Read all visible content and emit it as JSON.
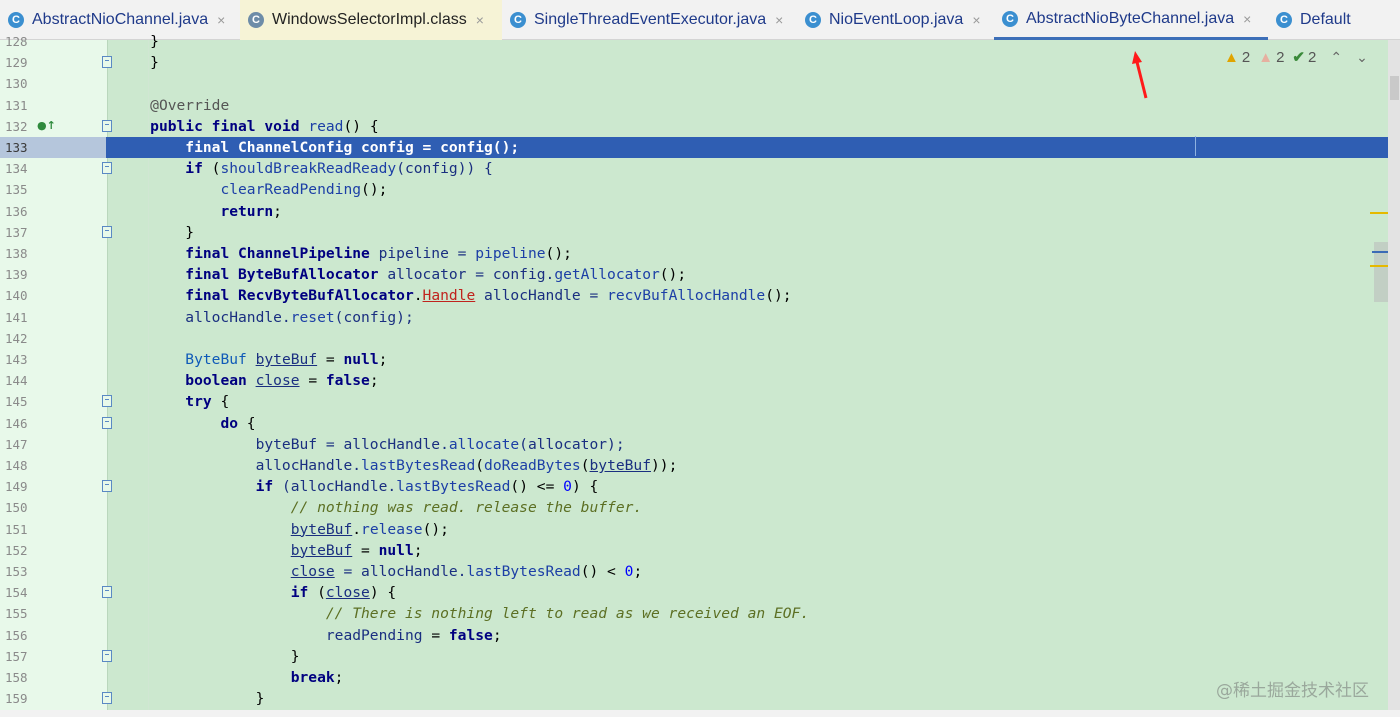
{
  "tabs": [
    {
      "label": "AbstractNioChannel.java",
      "icon": "java-class-icon",
      "kind": "java",
      "active": false,
      "closable": true
    },
    {
      "label": "WindowsSelectorImpl.class",
      "icon": "compiled-class-icon",
      "kind": "class",
      "active": false,
      "closable": true
    },
    {
      "label": "SingleThreadEventExecutor.java",
      "icon": "java-class-icon",
      "kind": "java",
      "active": false,
      "closable": true
    },
    {
      "label": "NioEventLoop.java",
      "icon": "java-class-icon",
      "kind": "java",
      "active": false,
      "closable": true
    },
    {
      "label": "AbstractNioByteChannel.java",
      "icon": "java-class-icon",
      "kind": "java",
      "active": true,
      "closable": true
    },
    {
      "label": "Default",
      "icon": "java-class-icon",
      "kind": "java",
      "active": false,
      "closable": false
    }
  ],
  "tab_icon_letter": "C",
  "close_glyph": "×",
  "inspections": {
    "warnings": "2",
    "weak_warnings": "2",
    "typos": "2",
    "warn_glyph": "▲",
    "weak_glyph": "▲",
    "typo_glyph": "✔",
    "prev_glyph": "⌃",
    "next_glyph": "⌄"
  },
  "editor": {
    "current_line": "133",
    "lines": [
      {
        "n": "128",
        "code": [
          {
            "t": "    }",
            "c": ""
          }
        ]
      },
      {
        "n": "129",
        "fold": true,
        "code": [
          {
            "t": "    }",
            "c": ""
          }
        ]
      },
      {
        "n": "130",
        "code": []
      },
      {
        "n": "131",
        "code": [
          {
            "t": "    ",
            "c": ""
          },
          {
            "t": "@Override",
            "c": "an"
          }
        ]
      },
      {
        "n": "132",
        "fold": true,
        "marker": "●↑",
        "code": [
          {
            "t": "    ",
            "c": ""
          },
          {
            "t": "public final void ",
            "c": "kw"
          },
          {
            "t": "read",
            "c": "fn"
          },
          {
            "t": "() {",
            "c": ""
          }
        ]
      },
      {
        "n": "133",
        "current": true,
        "code": [
          {
            "t": "        final ChannelConfig config = config();",
            "c": ""
          }
        ]
      },
      {
        "n": "134",
        "fold": true,
        "code": [
          {
            "t": "        ",
            "c": ""
          },
          {
            "t": "if ",
            "c": "kw"
          },
          {
            "t": "(",
            "c": ""
          },
          {
            "t": "shouldBreakReadReady",
            "c": "fn"
          },
          {
            "t": "(config)) {",
            "c": "lvar"
          }
        ]
      },
      {
        "n": "135",
        "code": [
          {
            "t": "            ",
            "c": ""
          },
          {
            "t": "clearReadPending",
            "c": "fn"
          },
          {
            "t": "();",
            "c": ""
          }
        ]
      },
      {
        "n": "136",
        "code": [
          {
            "t": "            ",
            "c": ""
          },
          {
            "t": "return",
            "c": "kw"
          },
          {
            "t": ";",
            "c": ""
          }
        ]
      },
      {
        "n": "137",
        "fold": true,
        "code": [
          {
            "t": "        }",
            "c": ""
          }
        ]
      },
      {
        "n": "138",
        "code": [
          {
            "t": "        ",
            "c": ""
          },
          {
            "t": "final ChannelPipeline ",
            "c": "kw"
          },
          {
            "t": "pipeline = ",
            "c": "lvar"
          },
          {
            "t": "pipeline",
            "c": "fn"
          },
          {
            "t": "();",
            "c": ""
          }
        ]
      },
      {
        "n": "139",
        "code": [
          {
            "t": "        ",
            "c": ""
          },
          {
            "t": "final ByteBufAllocator ",
            "c": "kw"
          },
          {
            "t": "allocator = config.",
            "c": "lvar"
          },
          {
            "t": "getAllocator",
            "c": "fn"
          },
          {
            "t": "();",
            "c": ""
          }
        ]
      },
      {
        "n": "140",
        "code": [
          {
            "t": "        ",
            "c": ""
          },
          {
            "t": "final RecvByteBufAllocator",
            "c": "kw"
          },
          {
            "t": ".",
            "c": ""
          },
          {
            "t": "Handle",
            "c": "err"
          },
          {
            "t": " allocHandle = ",
            "c": "lvar"
          },
          {
            "t": "recvBufAllocHandle",
            "c": "fn"
          },
          {
            "t": "();",
            "c": ""
          }
        ]
      },
      {
        "n": "141",
        "code": [
          {
            "t": "        allocHandle.",
            "c": "lvar"
          },
          {
            "t": "reset",
            "c": "fn"
          },
          {
            "t": "(config);",
            "c": "lvar"
          }
        ]
      },
      {
        "n": "142",
        "code": []
      },
      {
        "n": "143",
        "code": [
          {
            "t": "        ",
            "c": ""
          },
          {
            "t": "ByteBuf",
            "c": "ty"
          },
          {
            "t": " ",
            "c": ""
          },
          {
            "t": "byteBuf",
            "c": "lvar ul"
          },
          {
            "t": " = ",
            "c": ""
          },
          {
            "t": "null",
            "c": "kw"
          },
          {
            "t": ";",
            "c": ""
          }
        ]
      },
      {
        "n": "144",
        "code": [
          {
            "t": "        ",
            "c": ""
          },
          {
            "t": "boolean ",
            "c": "kw"
          },
          {
            "t": "close",
            "c": "lvar ul"
          },
          {
            "t": " = ",
            "c": ""
          },
          {
            "t": "false",
            "c": "kw"
          },
          {
            "t": ";",
            "c": ""
          }
        ]
      },
      {
        "n": "145",
        "fold": true,
        "code": [
          {
            "t": "        ",
            "c": ""
          },
          {
            "t": "try ",
            "c": "kw"
          },
          {
            "t": "{",
            "c": ""
          }
        ]
      },
      {
        "n": "146",
        "fold": true,
        "code": [
          {
            "t": "            ",
            "c": ""
          },
          {
            "t": "do ",
            "c": "kw"
          },
          {
            "t": "{",
            "c": ""
          }
        ]
      },
      {
        "n": "147",
        "code": [
          {
            "t": "                byteBuf = allocHandle.",
            "c": "lvar"
          },
          {
            "t": "allocate",
            "c": "fn"
          },
          {
            "t": "(allocator);",
            "c": "lvar"
          }
        ]
      },
      {
        "n": "148",
        "code": [
          {
            "t": "                allocHandle.",
            "c": "lvar"
          },
          {
            "t": "lastBytesRead",
            "c": "fn"
          },
          {
            "t": "(",
            "c": ""
          },
          {
            "t": "doReadBytes",
            "c": "fn"
          },
          {
            "t": "(",
            "c": ""
          },
          {
            "t": "byteBuf",
            "c": "lvar ul"
          },
          {
            "t": "));",
            "c": ""
          }
        ]
      },
      {
        "n": "149",
        "fold": true,
        "code": [
          {
            "t": "                ",
            "c": ""
          },
          {
            "t": "if ",
            "c": "kw"
          },
          {
            "t": "(allocHandle.",
            "c": "lvar"
          },
          {
            "t": "lastBytesRead",
            "c": "fn"
          },
          {
            "t": "() <= ",
            "c": ""
          },
          {
            "t": "0",
            "c": "num"
          },
          {
            "t": ") {",
            "c": ""
          }
        ]
      },
      {
        "n": "150",
        "code": [
          {
            "t": "                    ",
            "c": ""
          },
          {
            "t": "// nothing was read. release the buffer.",
            "c": "cm"
          }
        ]
      },
      {
        "n": "151",
        "code": [
          {
            "t": "                    ",
            "c": ""
          },
          {
            "t": "byteBuf",
            "c": "lvar ul"
          },
          {
            "t": ".",
            "c": ""
          },
          {
            "t": "release",
            "c": "fn"
          },
          {
            "t": "();",
            "c": ""
          }
        ]
      },
      {
        "n": "152",
        "code": [
          {
            "t": "                    ",
            "c": ""
          },
          {
            "t": "byteBuf",
            "c": "lvar ul"
          },
          {
            "t": " = ",
            "c": ""
          },
          {
            "t": "null",
            "c": "kw"
          },
          {
            "t": ";",
            "c": ""
          }
        ]
      },
      {
        "n": "153",
        "code": [
          {
            "t": "                    ",
            "c": ""
          },
          {
            "t": "close",
            "c": "lvar ul"
          },
          {
            "t": " = allocHandle.",
            "c": "lvar"
          },
          {
            "t": "lastBytesRead",
            "c": "fn"
          },
          {
            "t": "() < ",
            "c": ""
          },
          {
            "t": "0",
            "c": "num"
          },
          {
            "t": ";",
            "c": ""
          }
        ]
      },
      {
        "n": "154",
        "fold": true,
        "code": [
          {
            "t": "                    ",
            "c": ""
          },
          {
            "t": "if ",
            "c": "kw"
          },
          {
            "t": "(",
            "c": ""
          },
          {
            "t": "close",
            "c": "lvar ul"
          },
          {
            "t": ") {",
            "c": ""
          }
        ]
      },
      {
        "n": "155",
        "code": [
          {
            "t": "                        ",
            "c": ""
          },
          {
            "t": "// There is nothing left to read as we received an EOF.",
            "c": "cm"
          }
        ]
      },
      {
        "n": "156",
        "code": [
          {
            "t": "                        ",
            "c": ""
          },
          {
            "t": "readPending",
            "c": "lvar"
          },
          {
            "t": " = ",
            "c": ""
          },
          {
            "t": "false",
            "c": "kw"
          },
          {
            "t": ";",
            "c": ""
          }
        ]
      },
      {
        "n": "157",
        "fold": true,
        "code": [
          {
            "t": "                    }",
            "c": ""
          }
        ]
      },
      {
        "n": "158",
        "code": [
          {
            "t": "                    ",
            "c": ""
          },
          {
            "t": "break",
            "c": "kw"
          },
          {
            "t": ";",
            "c": ""
          }
        ]
      },
      {
        "n": "159",
        "fold": true,
        "code": [
          {
            "t": "                }",
            "c": ""
          }
        ]
      }
    ]
  },
  "watermark": "@稀土掘金技术社区",
  "colors": {
    "editor_bg": "#cce8cf",
    "gutter_bg": "#e8f9ea",
    "current_line": "#2f5eb3",
    "keyword": "#000080",
    "error": "#c0231d",
    "comment": "#5c6f23",
    "annotation_arrow": "#ff1a1a"
  }
}
